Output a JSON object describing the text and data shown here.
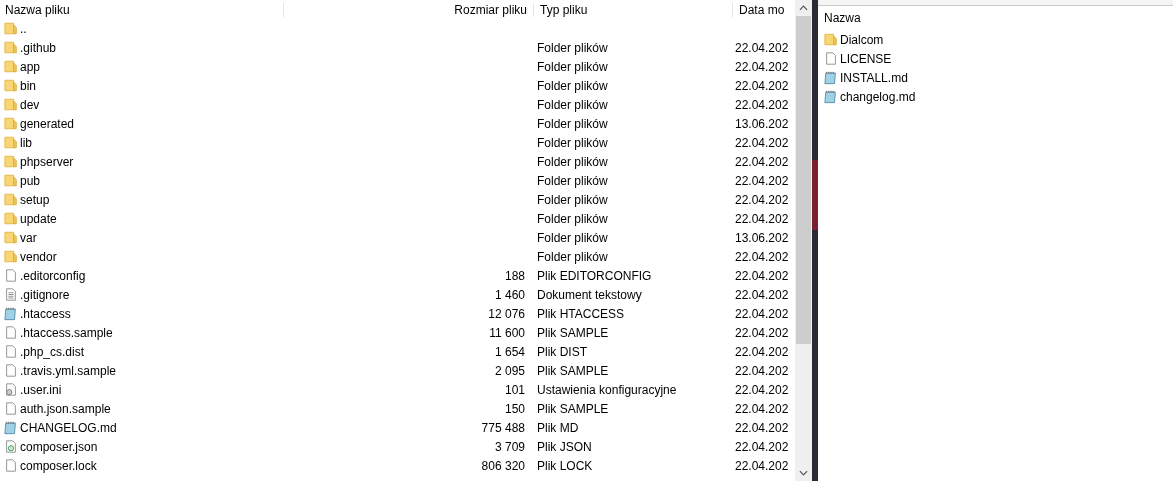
{
  "local": {
    "columns": [
      "Nazwa pliku",
      "Rozmiar pliku",
      "Typ pliku",
      "Data mo"
    ],
    "rows": [
      {
        "kind": "folder",
        "name": ".."
      },
      {
        "kind": "folder",
        "name": ".github",
        "type": "Folder plików",
        "date": "22.04.202"
      },
      {
        "kind": "folder",
        "name": "app",
        "type": "Folder plików",
        "date": "22.04.202"
      },
      {
        "kind": "folder",
        "name": "bin",
        "type": "Folder plików",
        "date": "22.04.202"
      },
      {
        "kind": "folder",
        "name": "dev",
        "type": "Folder plików",
        "date": "22.04.202"
      },
      {
        "kind": "folder",
        "name": "generated",
        "type": "Folder plików",
        "date": "13.06.202"
      },
      {
        "kind": "folder",
        "name": "lib",
        "type": "Folder plików",
        "date": "22.04.202"
      },
      {
        "kind": "folder",
        "name": "phpserver",
        "type": "Folder plików",
        "date": "22.04.202"
      },
      {
        "kind": "folder",
        "name": "pub",
        "type": "Folder plików",
        "date": "22.04.202"
      },
      {
        "kind": "folder",
        "name": "setup",
        "type": "Folder plików",
        "date": "22.04.202"
      },
      {
        "kind": "folder",
        "name": "update",
        "type": "Folder plików",
        "date": "22.04.202"
      },
      {
        "kind": "folder",
        "name": "var",
        "type": "Folder plików",
        "date": "13.06.202"
      },
      {
        "kind": "folder",
        "name": "vendor",
        "type": "Folder plików",
        "date": "22.04.202"
      },
      {
        "kind": "file",
        "name": ".editorconfig",
        "size": "188",
        "type": "Plik EDITORCONFIG",
        "date": "22.04.202"
      },
      {
        "kind": "text",
        "name": ".gitignore",
        "size": "1 460",
        "type": "Dokument tekstowy",
        "date": "22.04.202"
      },
      {
        "kind": "notepad",
        "name": ".htaccess",
        "size": "12 076",
        "type": "Plik HTACCESS",
        "date": "22.04.202"
      },
      {
        "kind": "file",
        "name": ".htaccess.sample",
        "size": "11 600",
        "type": "Plik SAMPLE",
        "date": "22.04.202"
      },
      {
        "kind": "file",
        "name": ".php_cs.dist",
        "size": "1 654",
        "type": "Plik DIST",
        "date": "22.04.202"
      },
      {
        "kind": "file",
        "name": ".travis.yml.sample",
        "size": "2 095",
        "type": "Plik SAMPLE",
        "date": "22.04.202"
      },
      {
        "kind": "gear",
        "name": ".user.ini",
        "size": "101",
        "type": "Ustawienia konfiguracyjne",
        "date": "22.04.202"
      },
      {
        "kind": "file",
        "name": "auth.json.sample",
        "size": "150",
        "type": "Plik SAMPLE",
        "date": "22.04.202"
      },
      {
        "kind": "notepad",
        "name": "CHANGELOG.md",
        "size": "775 488",
        "type": "Plik MD",
        "date": "22.04.202"
      },
      {
        "kind": "json",
        "name": "composer.json",
        "size": "3 709",
        "type": "Plik JSON",
        "date": "22.04.202"
      },
      {
        "kind": "file",
        "name": "composer.lock",
        "size": "806 320",
        "type": "Plik LOCK",
        "date": "22.04.202"
      }
    ]
  },
  "remote": {
    "columns": [
      "Nazwa"
    ],
    "rows": [
      {
        "kind": "folder",
        "name": "Dialcom"
      },
      {
        "kind": "file",
        "name": "LICENSE"
      },
      {
        "kind": "notepad",
        "name": "INSTALL.md"
      },
      {
        "kind": "notepad",
        "name": "changelog.md"
      }
    ]
  }
}
